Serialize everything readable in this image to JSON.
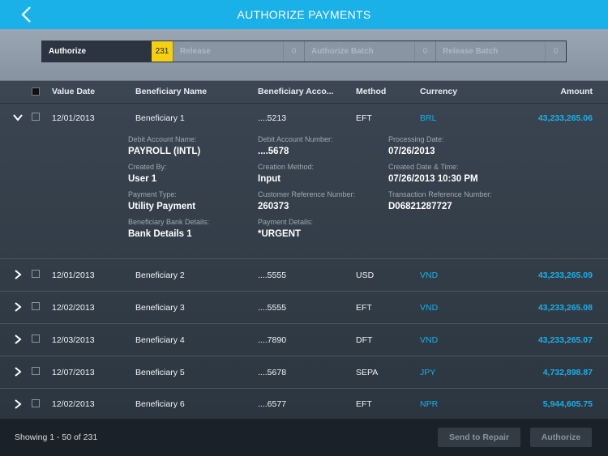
{
  "header": {
    "title": "AUTHORIZE PAYMENTS",
    "back_icon": "chevron-left-icon"
  },
  "tabs": [
    {
      "label": "Authorize",
      "count": "231",
      "active": true
    },
    {
      "label": "Release",
      "count": "0",
      "active": false
    },
    {
      "label": "Authorize Batch",
      "count": "0",
      "active": false
    },
    {
      "label": "Release Batch",
      "count": "0",
      "active": false
    }
  ],
  "columns": {
    "value_date": "Value Date",
    "beneficiary_name": "Beneficiary Name",
    "beneficiary_account": "Beneficiary Acco...",
    "method": "Method",
    "currency": "Currency",
    "amount": "Amount"
  },
  "rows": [
    {
      "date": "12/01/2013",
      "name": "Beneficiary 1",
      "account": "....5213",
      "method": "EFT",
      "currency": "BRL",
      "amount": "43,233,265.06"
    },
    {
      "date": "12/01/2013",
      "name": "Beneficiary 2",
      "account": "....5555",
      "method": "USD",
      "currency": "VND",
      "amount": "43,233,265.09"
    },
    {
      "date": "12/02/2013",
      "name": "Beneficiary 3",
      "account": "....5555",
      "method": "EFT",
      "currency": "VND",
      "amount": "43,233,265.08"
    },
    {
      "date": "12/03/2013",
      "name": "Beneficiary 4",
      "account": "....7890",
      "method": "DFT",
      "currency": "VND",
      "amount": "43,233,265.07"
    },
    {
      "date": "12/07/2013",
      "name": "Beneficiary 5",
      "account": "....5678",
      "method": "SEPA",
      "currency": "JPY",
      "amount": "4,732,898.87"
    },
    {
      "date": "12/02/2013",
      "name": "Beneficiary 6",
      "account": "....6577",
      "method": "EFT",
      "currency": "NPR",
      "amount": "5,944,605.75"
    }
  ],
  "details": {
    "debit_account_name_label": "Debit Account Name:",
    "debit_account_name": "PAYROLL (INTL)",
    "debit_account_number_label": "Debit Account Number:",
    "debit_account_number": "....5678",
    "processing_date_label": "Processing Date:",
    "processing_date": "07/26/2013",
    "created_by_label": "Created By:",
    "created_by": "User 1",
    "creation_method_label": "Creation Method:",
    "creation_method": "Input",
    "created_datetime_label": "Created Date & Time:",
    "created_datetime": "07/26/2013 10:30 PM",
    "payment_type_label": "Payment Type:",
    "payment_type": "Utility Payment",
    "customer_ref_label": "Customer Reference Number:",
    "customer_ref": "260373",
    "transaction_ref_label": "Transaction Reference Number:",
    "transaction_ref": "D06821287727",
    "bank_details_label": "Beneficiary Bank Details:",
    "bank_details": "Bank Details 1",
    "payment_details_label": "Payment Details:",
    "payment_details": "*URGENT"
  },
  "footer": {
    "showing": "Showing 1 - 50 of 231",
    "send_to_repair": "Send to Repair",
    "authorize": "Authorize"
  },
  "colors": {
    "accent": "#1ab0e8",
    "badge": "#f4cf12"
  }
}
